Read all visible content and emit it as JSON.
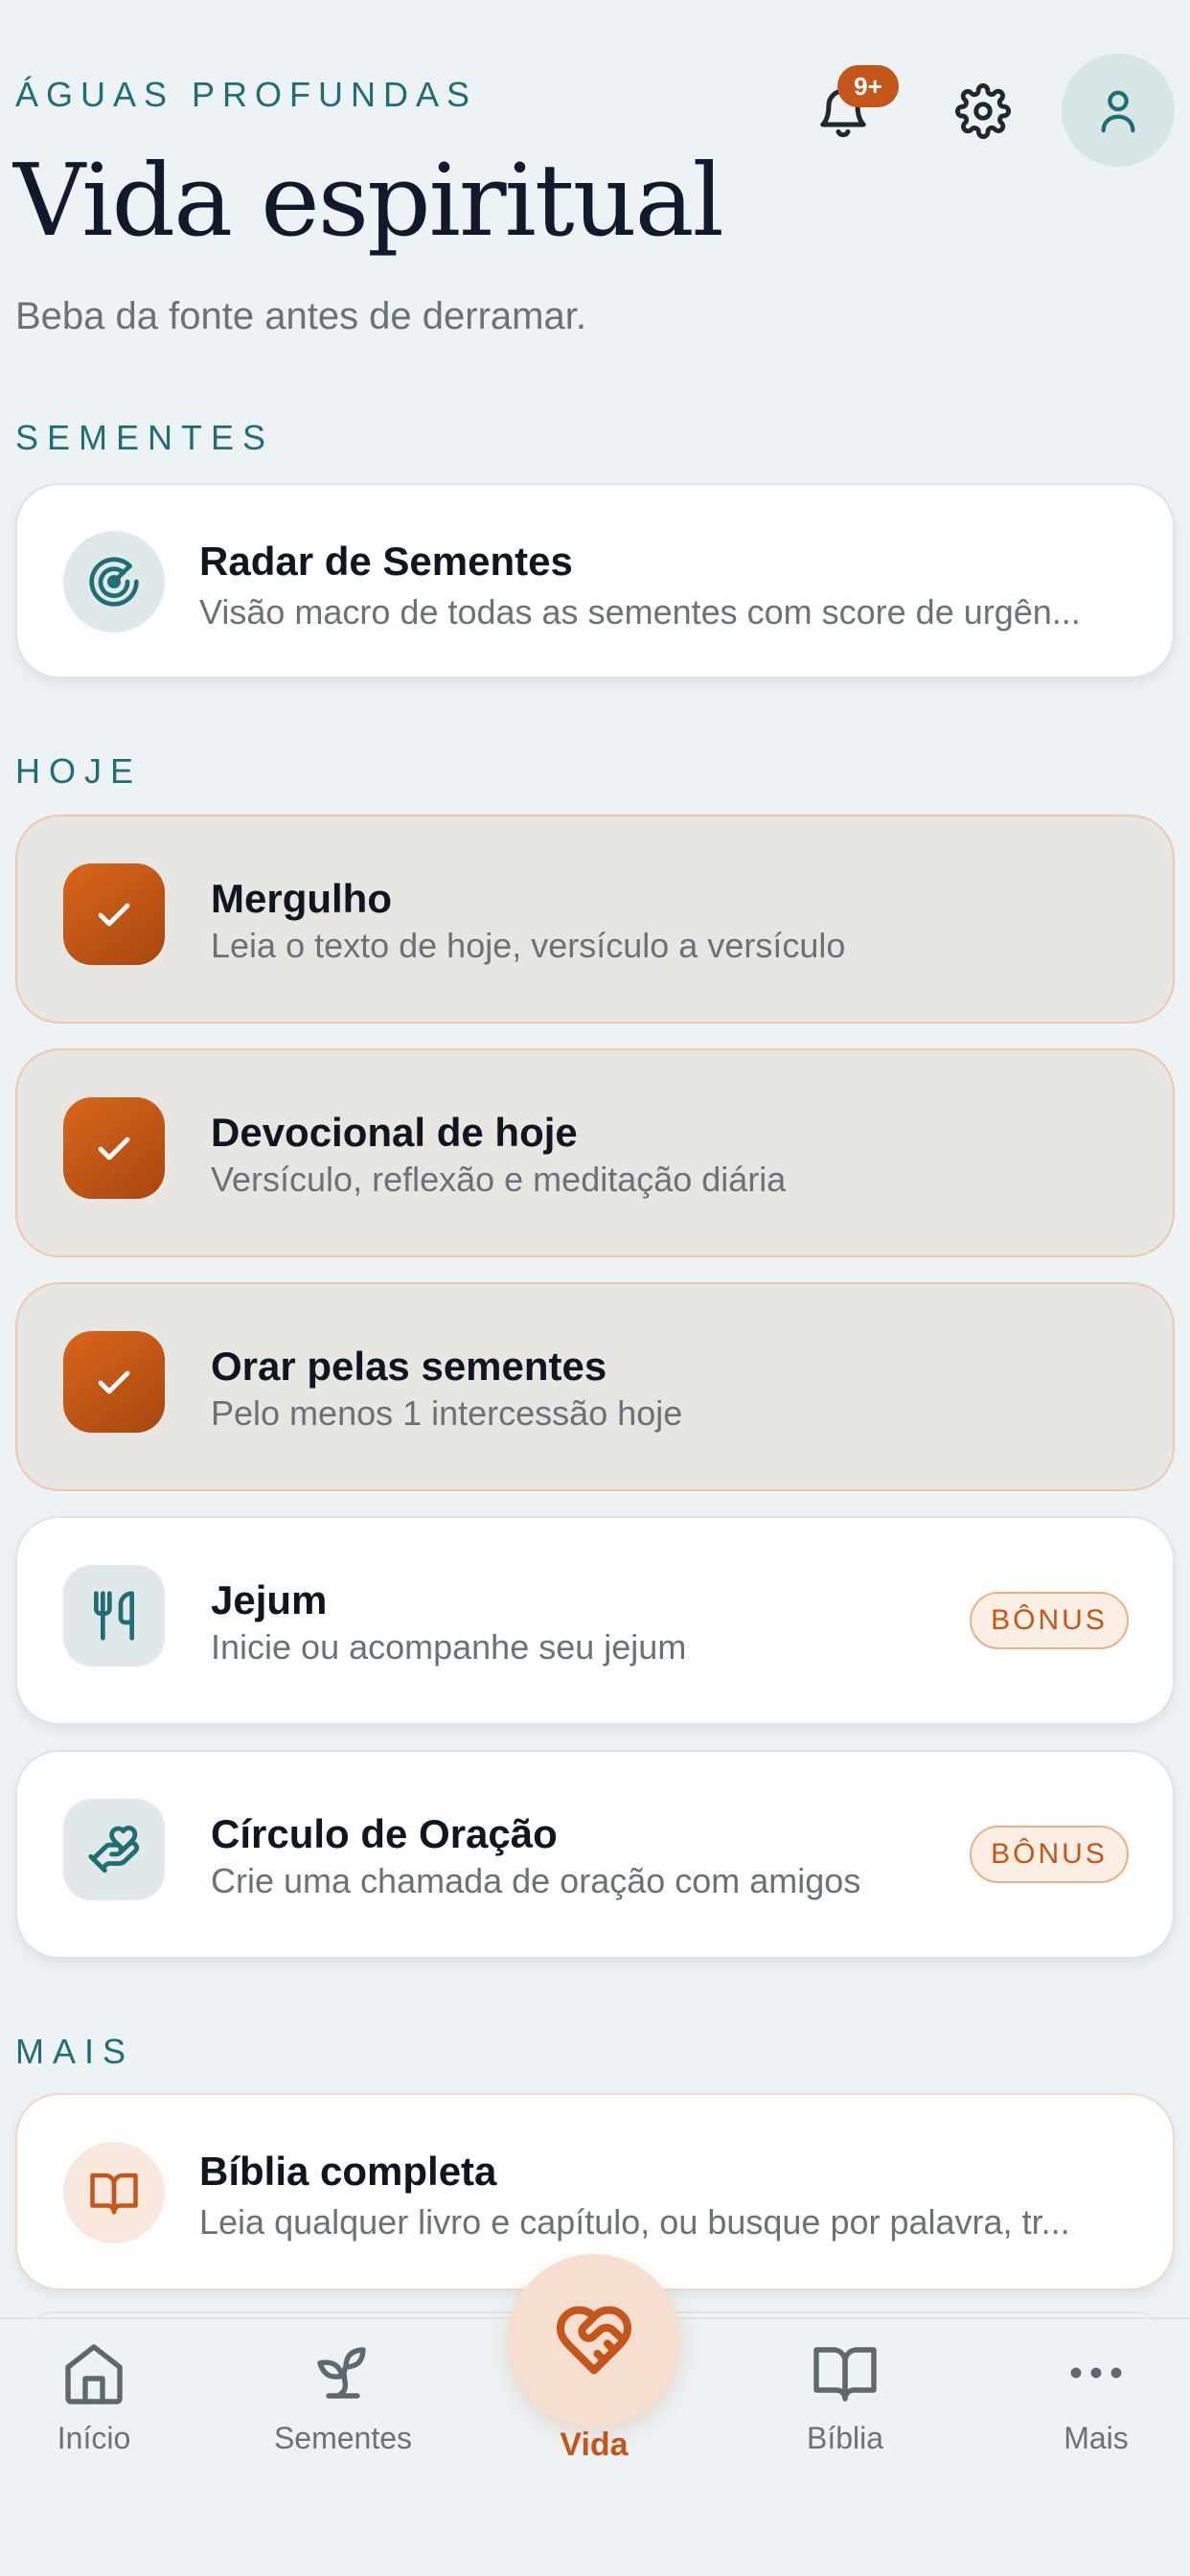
{
  "header": {
    "eyebrow": "ÁGUAS PROFUNDAS",
    "title": "Vida espiritual",
    "subtitle": "Beba da fonte antes de derramar.",
    "notification_badge": "9+"
  },
  "sections": {
    "seeds_label": "SEMENTES",
    "today_label": "HOJE",
    "more_label": "MAIS"
  },
  "seeds_card": {
    "title": "Radar de Sementes",
    "description": "Visão macro de todas as sementes com score de urgên...",
    "icon": "radar-icon"
  },
  "today_items": [
    {
      "title": "Mergulho",
      "description": "Leia o texto de hoje, versículo a versículo",
      "done": true
    },
    {
      "title": "Devocional de hoje",
      "description": "Versículo, reflexão e meditação diária",
      "done": true
    },
    {
      "title": "Orar pelas sementes",
      "description": "Pelo menos 1 intercessão hoje",
      "done": true
    },
    {
      "title": "Jejum",
      "description": "Inicie ou acompanhe seu jejum",
      "done": false,
      "badge": "BÔNUS",
      "icon": "utensils-icon"
    },
    {
      "title": "Círculo de Oração",
      "description": "Crie uma chamada de oração com amigos",
      "done": false,
      "badge": "BÔNUS",
      "icon": "heart-hand-icon"
    }
  ],
  "more_items": [
    {
      "title": "Bíblia completa",
      "description": "Leia qualquer livro e capítulo, ou busque por palavra, tr...",
      "icon": "book-icon"
    }
  ],
  "bottom_nav": {
    "items": [
      {
        "label": "Início",
        "icon": "home-icon"
      },
      {
        "label": "Sementes",
        "icon": "sprout-icon"
      },
      {
        "label": "Vida",
        "icon": "handshake-heart-icon",
        "active": true
      },
      {
        "label": "Bíblia",
        "icon": "book-icon"
      },
      {
        "label": "Mais",
        "icon": "more-dots-icon"
      }
    ]
  },
  "colors": {
    "background": "#edf2f4",
    "accent": "#c4561a",
    "teal": "#1f6e73",
    "done_card": "#e8e6e3"
  }
}
